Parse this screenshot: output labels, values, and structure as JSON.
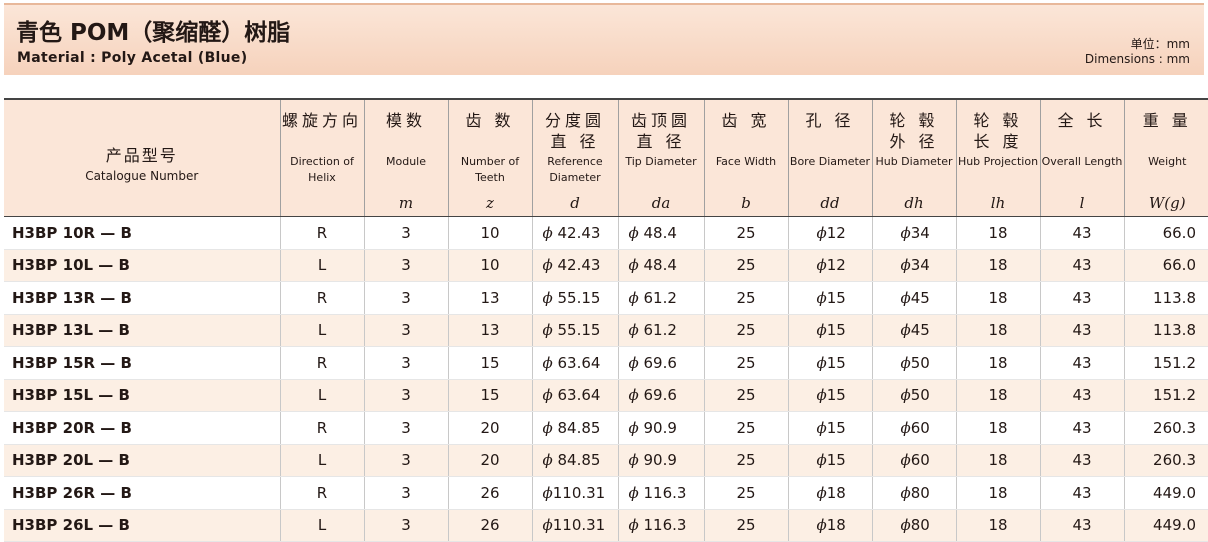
{
  "header": {
    "title": "青色 POM（聚缩醛）树脂",
    "subtitle": "Material : Poly Acetal (Blue)",
    "unit_cn": "单位：mm",
    "unit_en": "Dimensions : mm"
  },
  "columns": [
    {
      "cn": "产品型号",
      "en": "Catalogue Number",
      "sym": ""
    },
    {
      "cn": "螺旋方向",
      "en": "Direction of Helix",
      "sym": ""
    },
    {
      "cn": "模数",
      "en": "Module",
      "sym": "m"
    },
    {
      "cn": "齿 数",
      "en": "Number of Teeth",
      "sym": "z"
    },
    {
      "cn": "分度圆 直 径",
      "en": "Reference Diameter",
      "sym": "d"
    },
    {
      "cn": "齿顶圆 直 径",
      "en": "Tip Diameter",
      "sym": "da"
    },
    {
      "cn": "齿 宽",
      "en": "Face Width",
      "sym": "b"
    },
    {
      "cn": "孔 径",
      "en": "Bore Diameter",
      "sym": "dd"
    },
    {
      "cn": "轮 毂 外 径",
      "en": "Hub Diameter",
      "sym": "dh"
    },
    {
      "cn": "轮 毂 长 度",
      "en": "Hub Projection",
      "sym": "lh"
    },
    {
      "cn": "全 长",
      "en": "Overall Length",
      "sym": "l"
    },
    {
      "cn": "重 量",
      "en": "Weight",
      "sym": "W(g)"
    }
  ],
  "phi": "ϕ",
  "rows": [
    {
      "cat": "H3BP 10R — B",
      "helix": "R",
      "m": "3",
      "z": "10",
      "d": "42.43",
      "da": "48.4",
      "b": "25",
      "dd": "12",
      "dh": "34",
      "lh": "18",
      "l": "43",
      "w": "66.0"
    },
    {
      "cat": "H3BP 10L — B",
      "helix": "L",
      "m": "3",
      "z": "10",
      "d": "42.43",
      "da": "48.4",
      "b": "25",
      "dd": "12",
      "dh": "34",
      "lh": "18",
      "l": "43",
      "w": "66.0"
    },
    {
      "cat": "H3BP 13R — B",
      "helix": "R",
      "m": "3",
      "z": "13",
      "d": "55.15",
      "da": "61.2",
      "b": "25",
      "dd": "15",
      "dh": "45",
      "lh": "18",
      "l": "43",
      "w": "113.8"
    },
    {
      "cat": "H3BP 13L — B",
      "helix": "L",
      "m": "3",
      "z": "13",
      "d": "55.15",
      "da": "61.2",
      "b": "25",
      "dd": "15",
      "dh": "45",
      "lh": "18",
      "l": "43",
      "w": "113.8"
    },
    {
      "cat": "H3BP 15R — B",
      "helix": "R",
      "m": "3",
      "z": "15",
      "d": "63.64",
      "da": "69.6",
      "b": "25",
      "dd": "15",
      "dh": "50",
      "lh": "18",
      "l": "43",
      "w": "151.2"
    },
    {
      "cat": "H3BP 15L — B",
      "helix": "L",
      "m": "3",
      "z": "15",
      "d": "63.64",
      "da": "69.6",
      "b": "25",
      "dd": "15",
      "dh": "50",
      "lh": "18",
      "l": "43",
      "w": "151.2"
    },
    {
      "cat": "H3BP 20R — B",
      "helix": "R",
      "m": "3",
      "z": "20",
      "d": "84.85",
      "da": "90.9",
      "b": "25",
      "dd": "15",
      "dh": "60",
      "lh": "18",
      "l": "43",
      "w": "260.3"
    },
    {
      "cat": "H3BP 20L — B",
      "helix": "L",
      "m": "3",
      "z": "20",
      "d": "84.85",
      "da": "90.9",
      "b": "25",
      "dd": "15",
      "dh": "60",
      "lh": "18",
      "l": "43",
      "w": "260.3"
    },
    {
      "cat": "H3BP 26R — B",
      "helix": "R",
      "m": "3",
      "z": "26",
      "d": "110.31",
      "da": "116.3",
      "b": "25",
      "dd": "18",
      "dh": "80",
      "lh": "18",
      "l": "43",
      "w": "449.0"
    },
    {
      "cat": "H3BP 26L — B",
      "helix": "L",
      "m": "3",
      "z": "26",
      "d": "110.31",
      "da": "116.3",
      "b": "25",
      "dd": "18",
      "dh": "80",
      "lh": "18",
      "l": "43",
      "w": "449.0"
    }
  ]
}
